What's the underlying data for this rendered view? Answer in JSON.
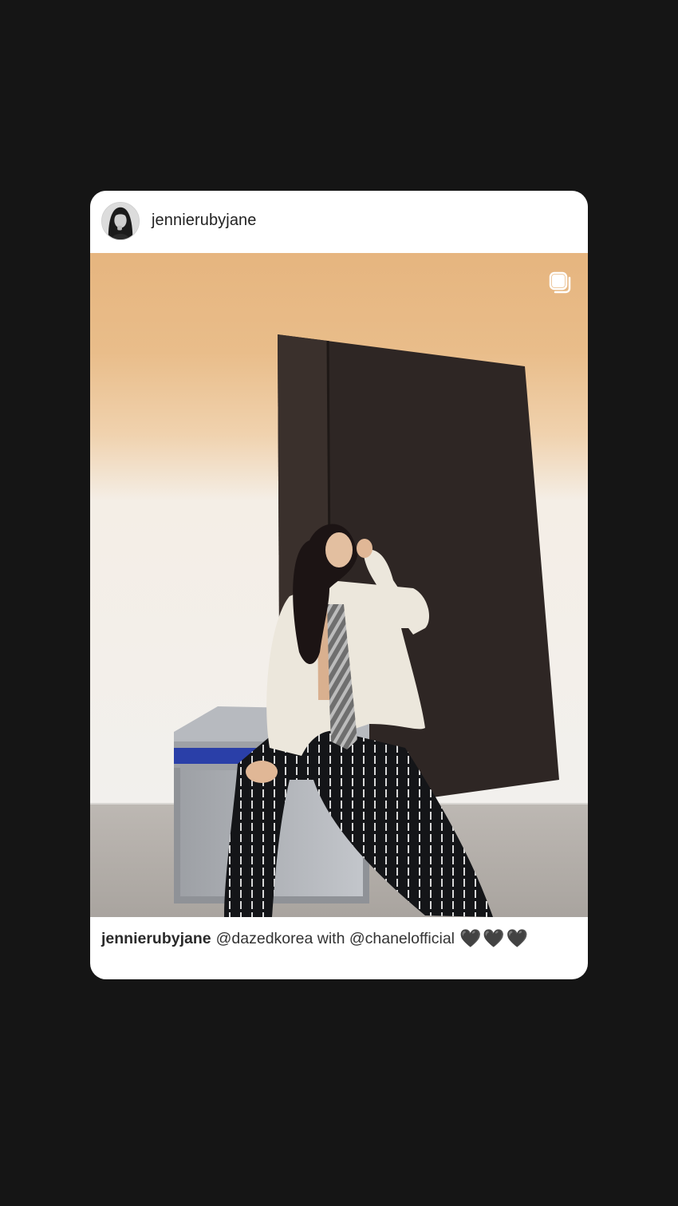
{
  "post": {
    "username": "jennierubyjane",
    "caption": {
      "username": "jennierubyjane",
      "text": "@dazedkorea with @chanelofficial",
      "hearts": "🖤🖤🖤"
    }
  },
  "icons": {
    "multi_image": "carousel-stack-icon",
    "avatar": "profile-avatar"
  },
  "colors": {
    "background": "#151515",
    "card": "#ffffff",
    "text": "#222222"
  }
}
